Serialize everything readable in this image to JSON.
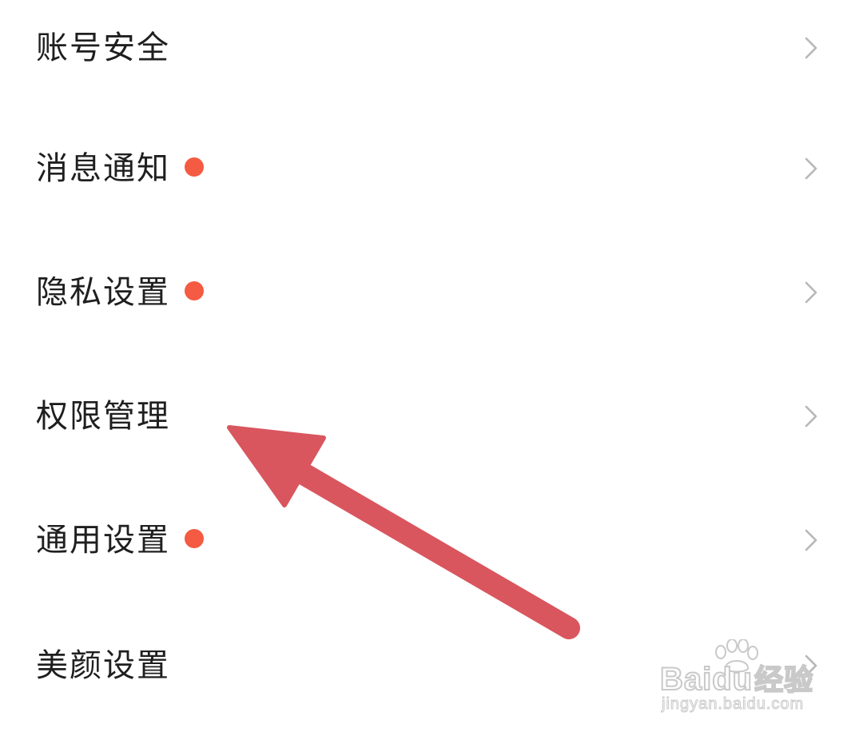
{
  "settings": {
    "items": [
      {
        "label": "账号安全",
        "has_dot": false
      },
      {
        "label": "消息通知",
        "has_dot": true
      },
      {
        "label": "隐私设置",
        "has_dot": true
      },
      {
        "label": "权限管理",
        "has_dot": false
      },
      {
        "label": "通用设置",
        "has_dot": true
      },
      {
        "label": "美颜设置",
        "has_dot": false
      }
    ]
  },
  "icons": {
    "chevron": "chevron-right-icon",
    "dot": "notification-dot",
    "arrow": "annotation-arrow-icon"
  },
  "colors": {
    "text": "#1f1f1f",
    "chevron": "#b8b8b8",
    "dot": "#f55a42",
    "arrow": "#d9565e",
    "watermark_outline": "#c9c9c9"
  },
  "watermark": {
    "brand": "Bai",
    "brand_suffix": "du",
    "product": "经验",
    "url": "jingyan.baidu.com"
  }
}
